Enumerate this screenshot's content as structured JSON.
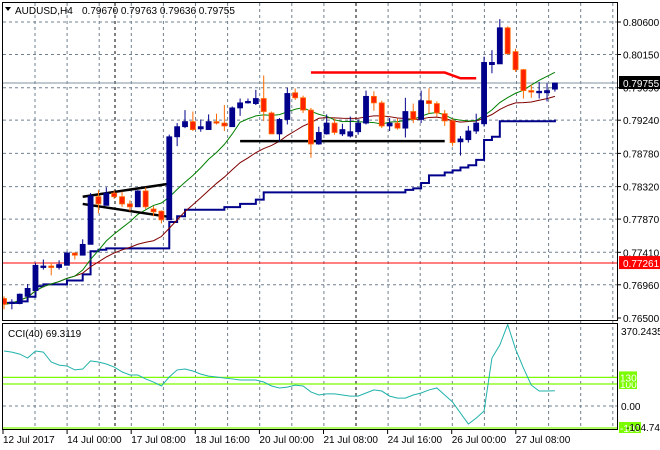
{
  "header": {
    "menu_icon": "triangle-down-icon",
    "symbol": "AUDUSD,H4",
    "ohlc": "0.79670 0.79763 0.79636 0.79755"
  },
  "colors": {
    "bull": "#00008b",
    "bear_fill": "#ff2200",
    "bear_border": "#ff6a00",
    "fast_ma": "#008000",
    "slow_ma": "#800000",
    "baseline": "#00008b",
    "support_line": "#ff0000",
    "cci": "#20b2aa",
    "cci_levels": "#7cfc00",
    "grid": "#708090"
  },
  "price_axis": {
    "labels": [
      "0.80600",
      "0.80150",
      "0.79690",
      "0.79240",
      "0.78780",
      "0.78320",
      "0.77870",
      "0.77410",
      "0.76960",
      "0.76500"
    ],
    "current_price": "0.79755",
    "support_price": "0.77261"
  },
  "cci_axis": {
    "title": "CCI(40) 69.3119",
    "max_label": "370.2435",
    "zero_label": "0.00",
    "min_label": "-104.7459",
    "level_high": "130",
    "level_mid": "100",
    "level_low": "-100"
  },
  "time_axis": {
    "labels": [
      "12 Jul 2017",
      "14 Jul 00:00",
      "17 Jul 08:00",
      "18 Jul 16:00",
      "20 Jul 00:00",
      "21 Jul 08:00",
      "24 Jul 16:00",
      "26 Jul 00:00",
      "27 Jul 08:00"
    ]
  },
  "chart_data": {
    "type": "candlestick",
    "symbol": "AUDUSD",
    "timeframe": "H4",
    "ylim": [
      0.765,
      0.806
    ],
    "cci_ylim": [
      -104.7459,
      370.2435
    ],
    "candles_ohlc": [
      [
        0.7677,
        0.768,
        0.7662,
        0.7669
      ],
      [
        0.767,
        0.7676,
        0.7662,
        0.7672
      ],
      [
        0.767,
        0.7684,
        0.7669,
        0.7683
      ],
      [
        0.768,
        0.7697,
        0.7673,
        0.7691
      ],
      [
        0.7688,
        0.7726,
        0.7688,
        0.7723
      ],
      [
        0.772,
        0.7731,
        0.7717,
        0.7722
      ],
      [
        0.7722,
        0.7727,
        0.7709,
        0.772
      ],
      [
        0.772,
        0.773,
        0.7717,
        0.7724
      ],
      [
        0.7723,
        0.7742,
        0.7723,
        0.774
      ],
      [
        0.774,
        0.7741,
        0.7731,
        0.7737
      ],
      [
        0.7737,
        0.7759,
        0.7737,
        0.7752
      ],
      [
        0.7752,
        0.7823,
        0.7752,
        0.7819
      ],
      [
        0.7818,
        0.7827,
        0.7795,
        0.7808
      ],
      [
        0.7806,
        0.7831,
        0.7806,
        0.7823
      ],
      [
        0.7823,
        0.7826,
        0.7815,
        0.7818
      ],
      [
        0.7818,
        0.7825,
        0.7804,
        0.7808
      ],
      [
        0.7808,
        0.7813,
        0.7798,
        0.7804
      ],
      [
        0.7804,
        0.7827,
        0.7804,
        0.7826
      ],
      [
        0.7826,
        0.7831,
        0.7801,
        0.7804
      ],
      [
        0.7801,
        0.7805,
        0.7791,
        0.7797
      ],
      [
        0.7798,
        0.7799,
        0.7781,
        0.7786
      ],
      [
        0.7786,
        0.7904,
        0.7786,
        0.7901
      ],
      [
        0.7901,
        0.792,
        0.7888,
        0.7915
      ],
      [
        0.7915,
        0.7938,
        0.7913,
        0.7922
      ],
      [
        0.7922,
        0.7936,
        0.7909,
        0.7911
      ],
      [
        0.7912,
        0.7925,
        0.7908,
        0.7915
      ],
      [
        0.7911,
        0.7932,
        0.7911,
        0.7922
      ],
      [
        0.7922,
        0.7933,
        0.7918,
        0.792
      ],
      [
        0.792,
        0.7945,
        0.7909,
        0.7916
      ],
      [
        0.7915,
        0.7943,
        0.7915,
        0.7941
      ],
      [
        0.7941,
        0.7954,
        0.793,
        0.7948
      ],
      [
        0.7948,
        0.7954,
        0.7947,
        0.795
      ],
      [
        0.7947,
        0.7966,
        0.7945,
        0.7954
      ],
      [
        0.7954,
        0.7986,
        0.7923,
        0.7936
      ],
      [
        0.7934,
        0.7936,
        0.7905,
        0.7905
      ],
      [
        0.7905,
        0.7927,
        0.7895,
        0.7925
      ],
      [
        0.7925,
        0.7969,
        0.7918,
        0.7961
      ],
      [
        0.7962,
        0.7968,
        0.7952,
        0.7955
      ],
      [
        0.7955,
        0.7958,
        0.7934,
        0.7938
      ],
      [
        0.7938,
        0.7941,
        0.7872,
        0.7891
      ],
      [
        0.7891,
        0.7915,
        0.789,
        0.7907
      ],
      [
        0.7905,
        0.7932,
        0.7904,
        0.792
      ],
      [
        0.792,
        0.7926,
        0.7904,
        0.7907
      ],
      [
        0.7905,
        0.7919,
        0.7902,
        0.7911
      ],
      [
        0.7902,
        0.7929,
        0.79,
        0.7908
      ],
      [
        0.7908,
        0.7925,
        0.7904,
        0.792
      ],
      [
        0.792,
        0.7965,
        0.7918,
        0.7957
      ],
      [
        0.7957,
        0.7964,
        0.7937,
        0.7948
      ],
      [
        0.7948,
        0.7951,
        0.7913,
        0.7916
      ],
      [
        0.7916,
        0.7927,
        0.7909,
        0.792
      ],
      [
        0.792,
        0.7926,
        0.7911,
        0.7913
      ],
      [
        0.7913,
        0.7955,
        0.79,
        0.7936
      ],
      [
        0.7936,
        0.7947,
        0.792,
        0.7925
      ],
      [
        0.7925,
        0.7965,
        0.792,
        0.7951
      ],
      [
        0.7951,
        0.7968,
        0.7933,
        0.7947
      ],
      [
        0.7947,
        0.795,
        0.7929,
        0.7934
      ],
      [
        0.7933,
        0.7938,
        0.7916,
        0.7923
      ],
      [
        0.7923,
        0.7926,
        0.7888,
        0.7893
      ],
      [
        0.7894,
        0.7902,
        0.7875,
        0.7898
      ],
      [
        0.7897,
        0.7916,
        0.7893,
        0.7909
      ],
      [
        0.7909,
        0.7933,
        0.7905,
        0.792
      ],
      [
        0.7919,
        0.8012,
        0.7915,
        0.8004
      ],
      [
        0.8001,
        0.8021,
        0.7989,
        0.8004
      ],
      [
        0.8002,
        0.8064,
        0.8002,
        0.8052
      ],
      [
        0.8052,
        0.8054,
        0.8016,
        0.8016
      ],
      [
        0.8019,
        0.8023,
        0.7991,
        0.7994
      ],
      [
        0.7994,
        0.7995,
        0.7954,
        0.7965
      ],
      [
        0.7965,
        0.7973,
        0.7955,
        0.7964
      ],
      [
        0.7962,
        0.7977,
        0.7954,
        0.7964
      ],
      [
        0.7962,
        0.7975,
        0.795,
        0.7965
      ],
      [
        0.7967,
        0.79763,
        0.79636,
        0.79755
      ]
    ],
    "fast_ma_period": 10,
    "slow_ma_period": 20,
    "baseline_period": 50,
    "cci_values": [
      250,
      245,
      236,
      218,
      250,
      245,
      200,
      186,
      182,
      164,
      168,
      205,
      200,
      191,
      177,
      155,
      141,
      141,
      123,
      109,
      91,
      132,
      164,
      168,
      159,
      145,
      136,
      132,
      127,
      123,
      118,
      118,
      118,
      109,
      91,
      82,
      86,
      95,
      91,
      64,
      50,
      55,
      55,
      50,
      45,
      45,
      59,
      73,
      68,
      45,
      36,
      36,
      50,
      59,
      73,
      82,
      50,
      18,
      -32,
      -82,
      -55,
      -23,
      218,
      277,
      370.24,
      259,
      173,
      95,
      68,
      68,
      69.31
    ],
    "cci_levels": [
      130,
      100,
      0,
      -100
    ],
    "trendlines": [
      {
        "name": "triangle-upper",
        "color": "#000000",
        "points": [
          [
            10,
            0.7818
          ],
          [
            21,
            0.7836
          ]
        ]
      },
      {
        "name": "triangle-lower",
        "color": "#000000",
        "points": [
          [
            10,
            0.7808
          ],
          [
            21,
            0.779
          ]
        ]
      },
      {
        "name": "support-range",
        "color": "#000000",
        "points": [
          [
            30,
            0.7895
          ],
          [
            56,
            0.7895
          ]
        ]
      },
      {
        "name": "resistance-range",
        "color": "#ff0000",
        "points": [
          [
            39,
            0.799
          ],
          [
            56,
            0.799
          ],
          [
            58,
            0.7982
          ],
          [
            60,
            0.7982
          ]
        ]
      }
    ],
    "horizontal_lines": [
      {
        "name": "current-price-line",
        "price": 0.79755,
        "color": "#8090a0"
      },
      {
        "name": "support-level-line",
        "price": 0.77261,
        "color": "#ff0000"
      }
    ]
  }
}
